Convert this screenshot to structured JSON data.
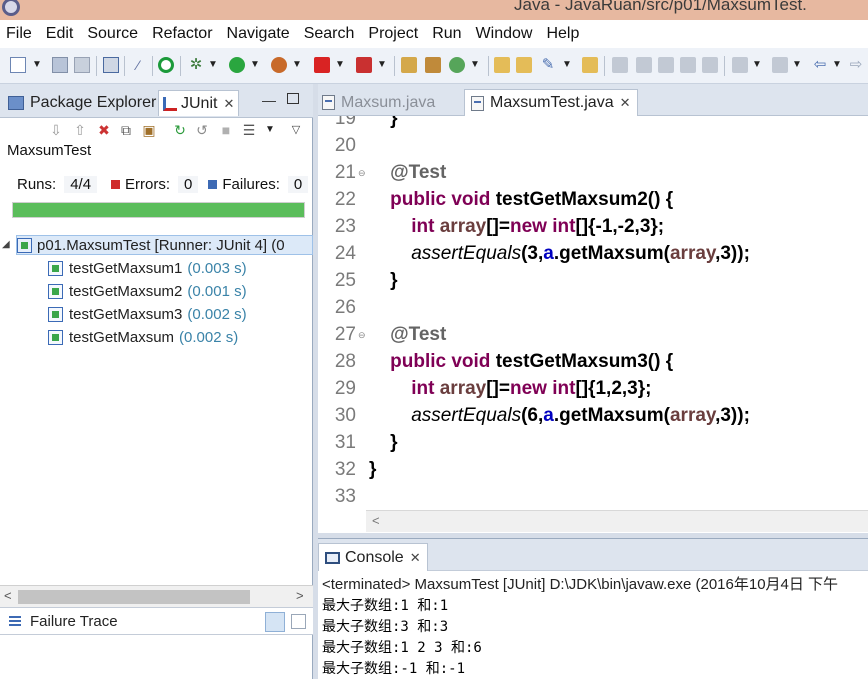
{
  "window": {
    "title": "Java - JavaRuan/src/p01/MaxsumTest."
  },
  "menu": [
    "File",
    "Edit",
    "Source",
    "Refactor",
    "Navigate",
    "Search",
    "Project",
    "Run",
    "Window",
    "Help"
  ],
  "left_panel": {
    "tabs": {
      "package_explorer": "Package Explorer",
      "junit": "JUnit"
    },
    "suite_name": "MaxsumTest",
    "runs_label": "Runs:",
    "runs_value": "4/4",
    "errors_label": "Errors:",
    "errors_value": "0",
    "failures_label": "Failures:",
    "failures_value": "0",
    "progress": 1.0,
    "progress_color": "#5bbd5b",
    "tree_root": "p01.MaxsumTest [Runner: JUnit 4] (0",
    "tests": [
      {
        "name": "testGetMaxsum1",
        "time": "(0.003 s)"
      },
      {
        "name": "testGetMaxsum2",
        "time": "(0.001 s)"
      },
      {
        "name": "testGetMaxsum3",
        "time": "(0.002 s)"
      },
      {
        "name": "testGetMaxsum",
        "time": "(0.002 s)"
      }
    ],
    "failure_trace": "Failure Trace"
  },
  "editor": {
    "tabs": [
      {
        "label": "Maxsum.java",
        "active": false
      },
      {
        "label": "MaxsumTest.java",
        "active": true
      }
    ],
    "lines": [
      {
        "num": "19",
        "parts": [
          [
            "    }",
            "plain"
          ]
        ]
      },
      {
        "num": "20",
        "parts": []
      },
      {
        "num": "21",
        "fold": true,
        "parts": [
          [
            "    ",
            "plain"
          ],
          [
            "@Test",
            "ann"
          ]
        ]
      },
      {
        "num": "22",
        "parts": [
          [
            "    ",
            "plain"
          ],
          [
            "public",
            "kw"
          ],
          [
            " ",
            "plain"
          ],
          [
            "void",
            "kw"
          ],
          [
            " testGetMaxsum2() {",
            "plain"
          ]
        ]
      },
      {
        "num": "23",
        "parts": [
          [
            "        ",
            "plain"
          ],
          [
            "int",
            "kw"
          ],
          [
            " ",
            "plain"
          ],
          [
            "array",
            "var"
          ],
          [
            "[]=",
            "plain"
          ],
          [
            "new",
            "kw"
          ],
          [
            " ",
            "plain"
          ],
          [
            "int",
            "kw"
          ],
          [
            "[]{-1,-2,3};",
            "plain"
          ]
        ]
      },
      {
        "num": "24",
        "parts": [
          [
            "        ",
            "plain"
          ],
          [
            "assertEquals",
            "it"
          ],
          [
            "(3,",
            "plain"
          ],
          [
            "a",
            "fld"
          ],
          [
            ".getMaxsum(",
            "plain"
          ],
          [
            "array",
            "var"
          ],
          [
            ",3));",
            "plain"
          ]
        ]
      },
      {
        "num": "25",
        "parts": [
          [
            "    }",
            "plain"
          ]
        ]
      },
      {
        "num": "26",
        "parts": []
      },
      {
        "num": "27",
        "fold": true,
        "parts": [
          [
            "    ",
            "plain"
          ],
          [
            "@Test",
            "ann"
          ]
        ]
      },
      {
        "num": "28",
        "parts": [
          [
            "    ",
            "plain"
          ],
          [
            "public",
            "kw"
          ],
          [
            " ",
            "plain"
          ],
          [
            "void",
            "kw"
          ],
          [
            " testGetMaxsum3() {",
            "plain"
          ]
        ]
      },
      {
        "num": "29",
        "parts": [
          [
            "        ",
            "plain"
          ],
          [
            "int",
            "kw"
          ],
          [
            " ",
            "plain"
          ],
          [
            "array",
            "var"
          ],
          [
            "[]=",
            "plain"
          ],
          [
            "new",
            "kw"
          ],
          [
            " ",
            "plain"
          ],
          [
            "int",
            "kw"
          ],
          [
            "[]{1,2,3};",
            "plain"
          ]
        ]
      },
      {
        "num": "30",
        "parts": [
          [
            "        ",
            "plain"
          ],
          [
            "assertEquals",
            "it"
          ],
          [
            "(6,",
            "plain"
          ],
          [
            "a",
            "fld"
          ],
          [
            ".getMaxsum(",
            "plain"
          ],
          [
            "array",
            "var"
          ],
          [
            ",3));",
            "plain"
          ]
        ]
      },
      {
        "num": "31",
        "parts": [
          [
            "    }",
            "plain"
          ]
        ]
      },
      {
        "num": "32",
        "parts": [
          [
            "}",
            "plain"
          ]
        ]
      },
      {
        "num": "33",
        "parts": []
      }
    ]
  },
  "console": {
    "tab_label": "Console",
    "status": "<terminated> MaxsumTest [JUnit] D:\\JDK\\bin\\javaw.exe (2016年10月4日 下午",
    "output": [
      "最大子数组:1 和:1",
      "最大子数组:3 和:3",
      "最大子数组:1 2 3 和:6",
      "最大子数组:-1 和:-1"
    ]
  }
}
